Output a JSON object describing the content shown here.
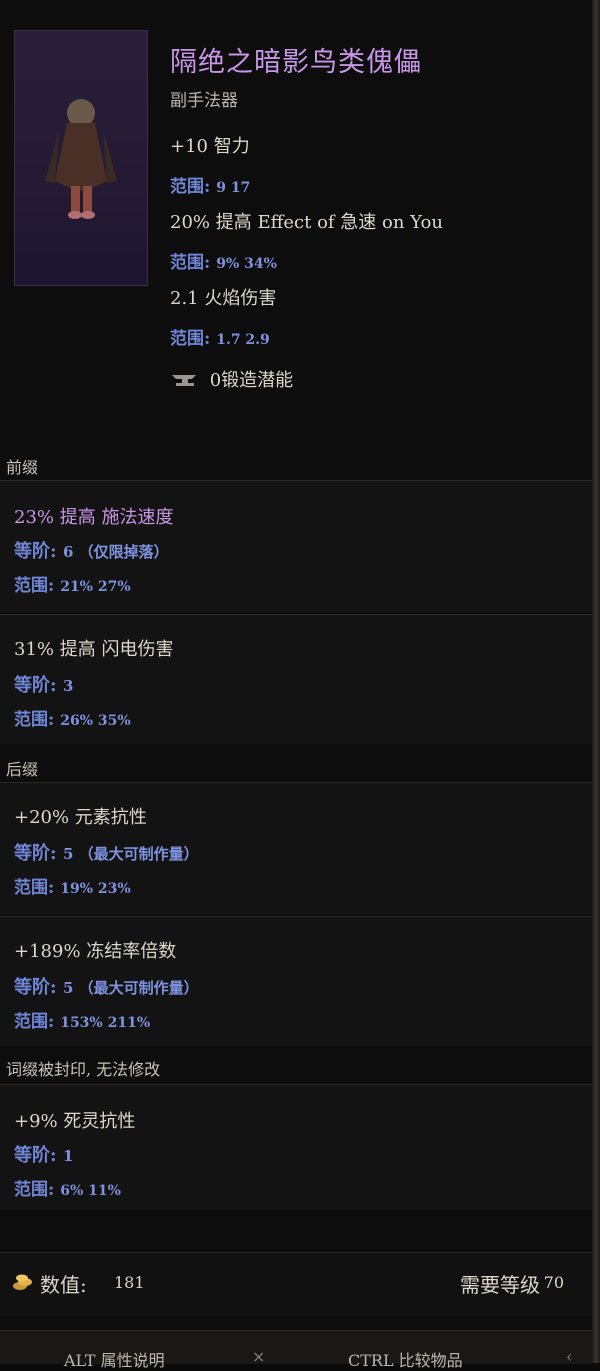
{
  "item": {
    "name": "隔绝之暗影鸟类傀儡",
    "type": "副手法器",
    "implicits": [
      {
        "text": "+10 智力",
        "range_label": "范围:",
        "range": "9  17"
      },
      {
        "text": "20% 提高 Effect of 急速 on You",
        "range_label": "范围:",
        "range": "9%  34%"
      },
      {
        "text": "2.1 火焰伤害",
        "range_label": "范围:",
        "range": "1.7  2.9"
      }
    ],
    "forge_potential": "0锻造潜能"
  },
  "sections": {
    "prefix_label": "前缀",
    "suffix_label": "后缀",
    "sealed_label": "词缀被封印, 无法修改"
  },
  "prefixes": [
    {
      "text": "23% 提高 施法速度",
      "tier_label": "等阶:",
      "tier": "6 （仅限掉落）",
      "range_label": "范围:",
      "range": "21%  27%"
    },
    {
      "text": "31% 提高 闪电伤害",
      "tier_label": "等阶:",
      "tier": "3",
      "range_label": "范围:",
      "range": "26%  35%"
    }
  ],
  "suffixes": [
    {
      "text": "+20% 元素抗性",
      "tier_label": "等阶:",
      "tier": "5 （最大可制作量）",
      "range_label": "范围:",
      "range": "19%  23%"
    },
    {
      "text": "+189% 冻结率倍数",
      "tier_label": "等阶:",
      "tier": "5 （最大可制作量）",
      "range_label": "范围:",
      "range": "153%  211%"
    }
  ],
  "sealed": [
    {
      "text": "+9% 死灵抗性",
      "tier_label": "等阶:",
      "tier": "1",
      "range_label": "范围:",
      "range": "6%  11%"
    }
  ],
  "footer": {
    "value_label": "数值:",
    "value": "181",
    "req_label": "需要等级",
    "req_level": "70"
  },
  "hints": {
    "alt": "ALT 属性说明",
    "ctrl": "CTRL 比较物品"
  },
  "colors": {
    "title": "#c796e6",
    "range": "#6f86d6",
    "text": "#ddd6ca"
  },
  "icons": [
    "anvil-icon",
    "coin-icon"
  ]
}
